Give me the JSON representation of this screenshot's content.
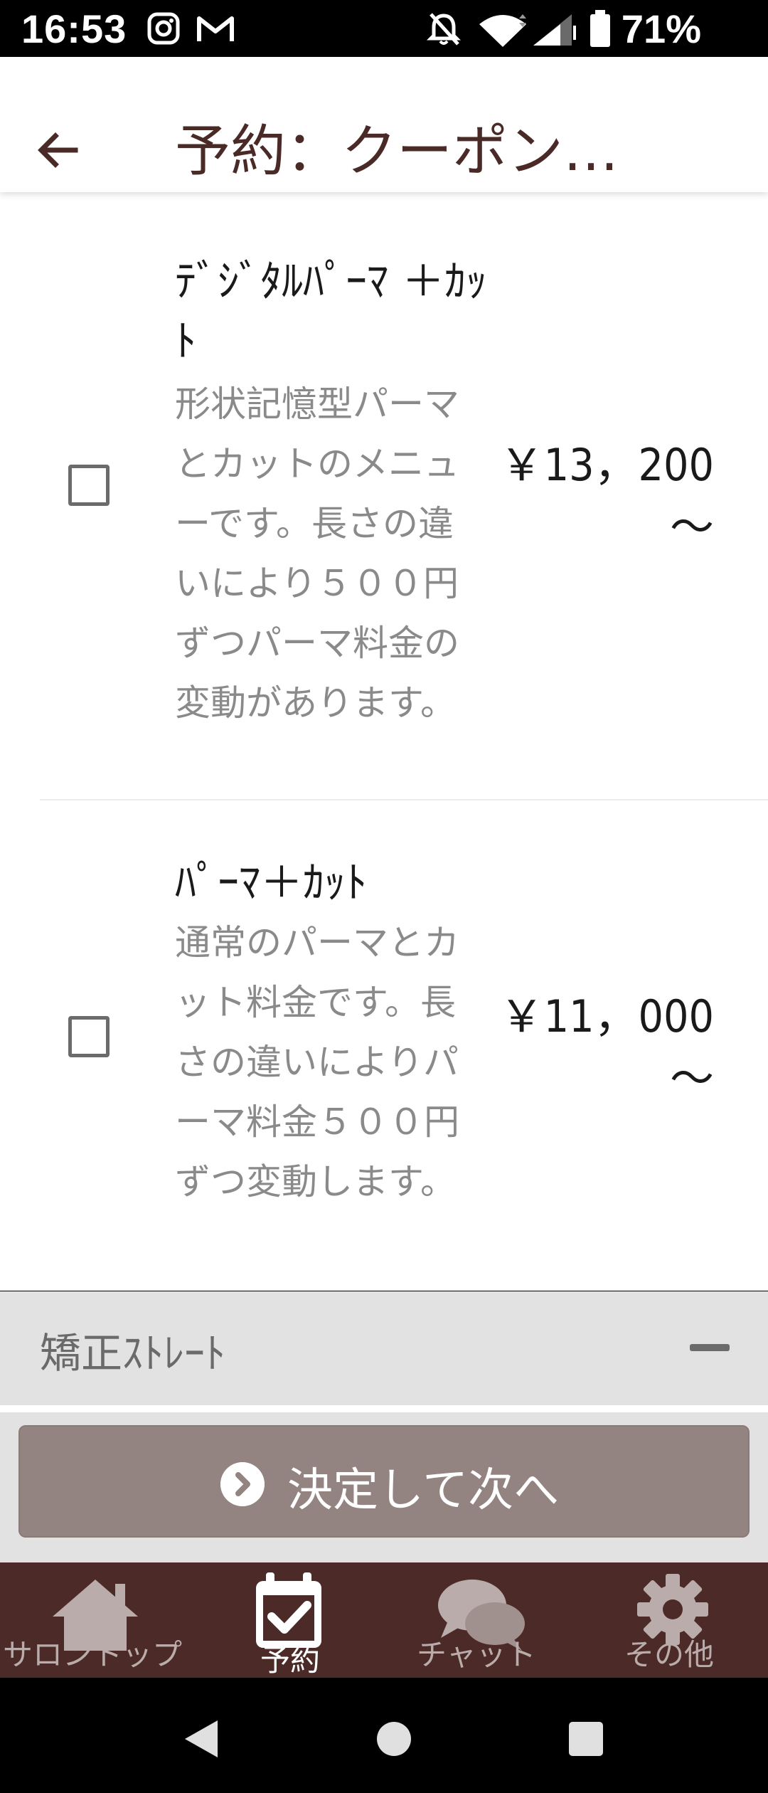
{
  "status_bar": {
    "time": "16:53",
    "icons_left": [
      "instagram-icon",
      "gmail-icon"
    ],
    "icons_right": [
      "muted-bell-icon",
      "wifi-icon",
      "signal-icon",
      "battery-icon"
    ],
    "battery": "71%"
  },
  "header": {
    "title": "予約：クーポン…"
  },
  "coupons": [
    {
      "title": "ﾃﾞｼﾞﾀﾙﾊﾟｰﾏ ＋ｶｯﾄ",
      "description": "形状記憶型パーマとカットのメニューです。長さの違いにより５００円ずつパーマ料金の変動があります。",
      "price": "￥13，200",
      "price_suffix": "～",
      "checked": false
    },
    {
      "title": "ﾊﾟｰﾏ＋ｶｯﾄ",
      "description": "通常のパーマとカット料金です。長さの違いによりパーマ料金５００円ずつ変動します。",
      "price": "￥11，000",
      "price_suffix": "～",
      "checked": false
    }
  ],
  "section": {
    "title": "矯正ｽﾄﾚｰﾄ"
  },
  "confirm_button": {
    "label": "決定して次へ"
  },
  "bottom_nav": [
    {
      "label": "サロントップ",
      "icon": "home-icon",
      "active": false
    },
    {
      "label": "予約",
      "icon": "calendar-check-icon",
      "active": true
    },
    {
      "label": "チャット",
      "icon": "chat-bubbles-icon",
      "active": false
    },
    {
      "label": "その他",
      "icon": "gear-icon",
      "active": false
    }
  ],
  "colors": {
    "brand_dark": "#4b2a27",
    "title_text": "#4a2a26",
    "button_bg": "#938381",
    "section_bg": "#e2e2e2"
  }
}
